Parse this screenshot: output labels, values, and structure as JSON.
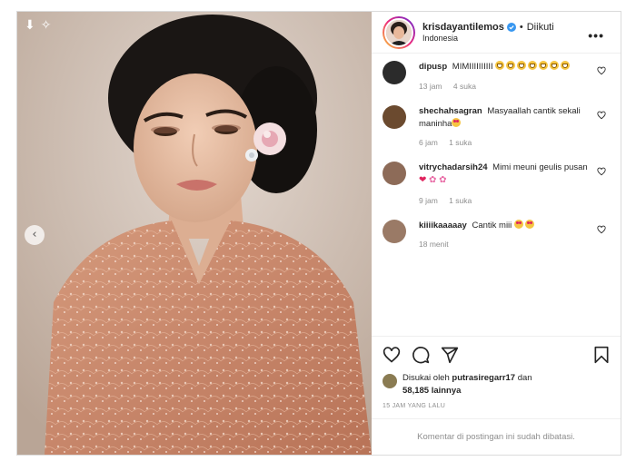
{
  "post": {
    "username": "krisdayantilemos",
    "follow_status": "Diikuti",
    "separator": "•",
    "location": "Indonesia"
  },
  "comments": [
    {
      "user": "dipusp",
      "text": "MIMIIIIIIIIII",
      "time": "13 jam",
      "likes": "4 suka",
      "avatar_color": "#2b2b2b"
    },
    {
      "user": "shechahsagran",
      "text": "Masyaallah cantik sekali maninha",
      "time": "6 jam",
      "likes": "1 suka",
      "avatar_color": "#6b4a2f"
    },
    {
      "user": "vitrychadarsih24",
      "text": "Mimi meuni geulis pusan",
      "time": "9 jam",
      "likes": "1 suka",
      "avatar_color": "#8d6b58"
    },
    {
      "user": "kiiiikaaaaay",
      "text": "Cantik miii",
      "time": "18 menit",
      "likes": "",
      "avatar_color": "#9a7a66"
    }
  ],
  "likes": {
    "prefix": "Disukai oleh",
    "user": "putrasiregarr17",
    "connector": "dan",
    "count": "58,185 lainnya"
  },
  "timestamp": "15 JAM YANG LALU",
  "comments_disabled": "Komentar di postingan ini sudah dibatasi.",
  "icons": [
    "heart-icon",
    "comment-icon",
    "share-icon",
    "bookmark-icon",
    "more-icon",
    "verified-icon",
    "chevron-left-icon"
  ],
  "colors": {
    "verified": "#3897f0",
    "heart_emoji": "#e0245e",
    "text": "#262626",
    "muted": "#8e8e8e"
  }
}
